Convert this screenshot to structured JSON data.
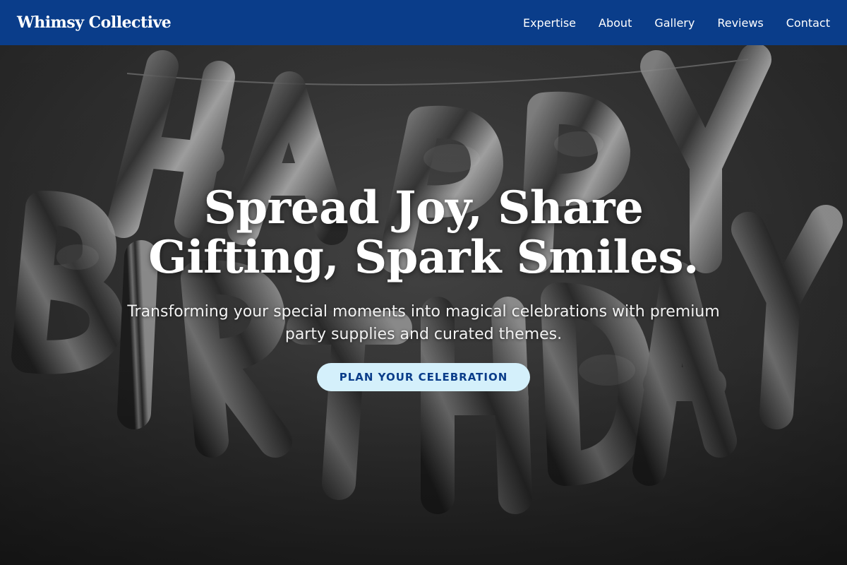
{
  "navbar": {
    "brand": "Whimsy Collective",
    "links": [
      "Expertise",
      "About",
      "Gallery",
      "Reviews",
      "Contact"
    ]
  },
  "hero": {
    "title": "Spread Joy, Share Gifting, Spark Smiles.",
    "subtitle": "Transforming your special moments into magical celebrations with premium party supplies and curated themes.",
    "cta_label": "PLAN YOUR CELEBRATION",
    "background_image": "silver-happy-birthday-balloons"
  },
  "colors": {
    "nav_bg": "#0a3d8a",
    "cta_bg": "#d4f0fb",
    "cta_text": "#0a3d8a",
    "hero_text": "#ffffff"
  }
}
